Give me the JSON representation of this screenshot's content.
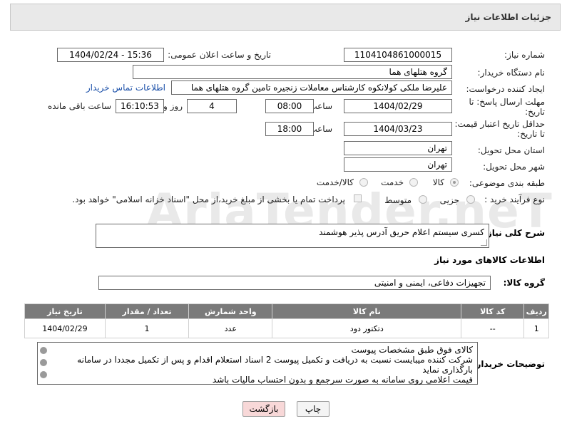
{
  "title": "جزئیات اطلاعات نیاز",
  "watermark": "AriaTender.neT",
  "labels": {
    "need_number": "شماره نیاز:",
    "announce_datetime": "تاریخ و ساعت اعلان عمومی:",
    "buyer_org": "نام دستگاه خریدار:",
    "requester": "ایجاد کننده درخواست:",
    "reply_deadline": "مهلت ارسال پاسخ: تا تاریخ:",
    "time": "ساعت",
    "day_and": "روز و",
    "remaining": "ساعت باقی مانده",
    "price_validity": "حداقل تاریخ اعتبار قیمت: تا تاریخ:",
    "province": "استان محل تحویل:",
    "city": "شهر محل تحویل:",
    "category": "طبقه بندی موضوعی:",
    "purchase_type": "نوع فرآیند خرید :",
    "description": "شرح کلی نیاز:",
    "goods_info": "اطلاعات کالاهای مورد نیاز",
    "goods_group": "گروه کالا:",
    "buyer_notes": "توضیحات خریدار:"
  },
  "values": {
    "need_number": "1104104861000015",
    "announce_datetime": "1404/02/24 - 15:36",
    "buyer_org": "گروه هتلهای هما",
    "requester": "علیرضا ملکی کولانکوه کارشناس معاملات زنجیره تامین گروه هتلهای هما",
    "contact_link": "اطلاعات تماس خریدار",
    "reply_date": "1404/02/29",
    "reply_time": "08:00",
    "reply_days": "4",
    "remaining_time": "16:10:53",
    "validity_date": "1404/03/23",
    "validity_time": "18:00",
    "province": "تهران",
    "city": "تهران",
    "description": "کسری سیستم اعلام حریق آدرس پذیر هوشمند",
    "goods_group": "تجهیزات دفاعی، ایمنی و امنیتی"
  },
  "category_options": {
    "goods": "کالا",
    "service": "خدمت",
    "goods_service": "کالا/خدمت",
    "selected": "goods"
  },
  "purchase_options": {
    "partial": "جزیی",
    "medium": "متوسط",
    "treasury_note": "پرداخت تمام یا بخشی از مبلغ خرید،از محل \"اسناد خزانه اسلامی\" خواهد بود."
  },
  "table": {
    "headers": [
      "ردیف",
      "کد کالا",
      "نام کالا",
      "واحد شمارش",
      "تعداد / مقدار",
      "تاریخ نیاز"
    ],
    "rows": [
      [
        "1",
        "--",
        "دتکتور دود",
        "عدد",
        "1",
        "1404/02/29"
      ]
    ]
  },
  "buyer_notes": "کالای فوق طبق مشخصات پیوست\nشرکت کننده میبایست نسبت به دریافت و تکمیل پیوست 2 اسناد استعلام اقدام و پس از تکمیل مجددا در سامانه بارگذاری نماید\nقیمت اعلامی روی سامانه به صورت سرجمع و بدون احتساب مالیات باشد",
  "buttons": {
    "print": "چاپ",
    "back": "بازگشت"
  },
  "colors": {
    "header_bar": "#e9e9e9",
    "table_header": "#7a7a7a",
    "link": "#1a4fa8",
    "back_button": "#f8d8d8"
  }
}
